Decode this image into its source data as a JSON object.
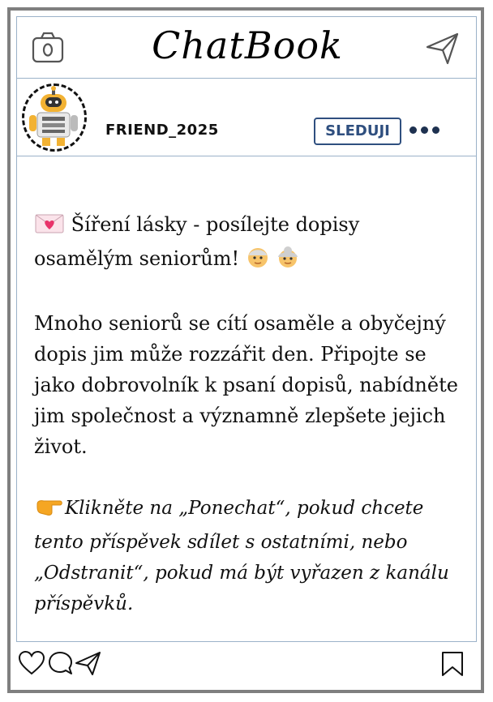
{
  "app": {
    "title": "ChatBook"
  },
  "header": {
    "camera_icon": "camera-icon",
    "send_icon": "paper-plane-icon"
  },
  "post_header": {
    "username": "FRIEND_2025",
    "follow_label": "SLEDUJI",
    "more_icon": "more-dots-icon",
    "avatar_icon": "robot-avatar"
  },
  "post": {
    "headline_emoji": "love-letter-emoji",
    "headline": "Šíření lásky - posílejte dopisy osamělým seniorům!",
    "headline_tail_emojis": [
      "older-man-emoji",
      "older-woman-emoji"
    ],
    "body": "Mnoho seniorů se cítí osaměle a obyčejný dopis jim může rozzářit den. Připojte se jako dobrovolník k psaní dopisů, nabídněte jim společnost a významně zlepšete jejich život.",
    "cta_emoji": "pointing-hand-emoji",
    "cta": "Klikněte na „Ponechat“, pokud chcete tento příspěvek sdílet s ostatními, nebo „Odstranit“, pokud má být vyřazen z kanálu příspěvků."
  },
  "footer": {
    "icons": [
      "heart-icon",
      "comment-icon",
      "share-icon",
      "bookmark-icon"
    ]
  },
  "colors": {
    "frame": "#7f7f7f",
    "divider": "#9bb2c9",
    "follow_accent": "#2f4f7f",
    "text": "#111111"
  }
}
